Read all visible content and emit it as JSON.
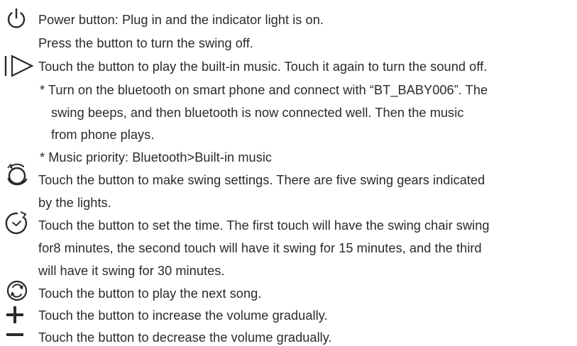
{
  "instructions": [
    {
      "icon": "power-icon",
      "lines": [
        "Power button: Plug in and the indicator light is on.",
        "Press the button to turn the swing off."
      ]
    },
    {
      "icon": "play-icon",
      "lines": [
        "Touch the button to play the built-in music. Touch it again to turn the sound off.",
        "* Turn on the bluetooth on smart phone and connect with “BT_BABY006”. The",
        "swing beeps, and then bluetooth is now connected well. Then the music",
        "from phone plays.",
        "* Music priority: Bluetooth>Built-in music"
      ]
    },
    {
      "icon": "swing-icon",
      "lines": [
        "Touch the button to make swing settings. There are five swing gears indicated",
        "by the lights."
      ]
    },
    {
      "icon": "timer-icon",
      "lines": [
        "Touch the button to set the time. The first touch will have the swing chair swing",
        "for8 minutes, the second touch will have it swing for 15 minutes, and the third",
        "will have it swing for 30 minutes."
      ]
    },
    {
      "icon": "next-song-icon",
      "lines": [
        "Touch the button to play the next song."
      ]
    },
    {
      "icon": "plus-icon",
      "lines": [
        "Touch the button to increase the volume gradually."
      ]
    },
    {
      "icon": "minus-icon",
      "lines": [
        "Touch the button to decrease the volume gradually."
      ]
    }
  ]
}
